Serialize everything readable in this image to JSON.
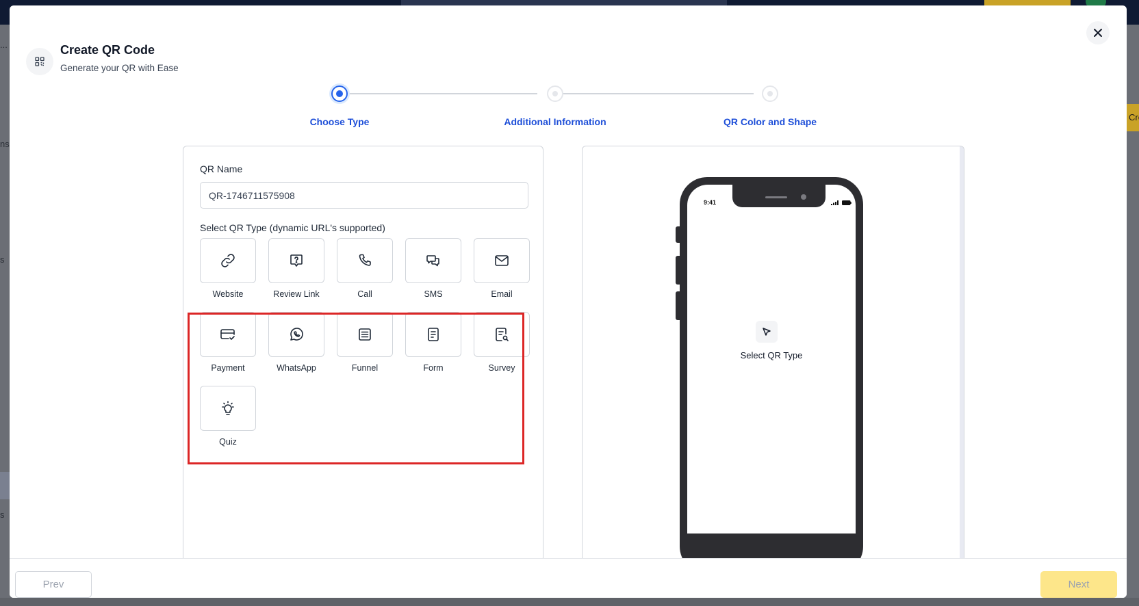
{
  "background": {
    "side_labels": [
      "...",
      "ns",
      "s",
      "s"
    ],
    "right_tab": "Cre"
  },
  "modal": {
    "title": "Create QR Code",
    "subtitle": "Generate your QR with Ease",
    "header_icon": "qr-code-icon",
    "close_icon": "close-icon"
  },
  "stepper": {
    "steps": [
      {
        "label": "Choose Type",
        "state": "active"
      },
      {
        "label": "Additional Information",
        "state": "pending"
      },
      {
        "label": "QR Color and Shape",
        "state": "pending"
      }
    ],
    "active_color": "#2563eb"
  },
  "form": {
    "name_label": "QR Name",
    "name_value": "QR-1746711575908",
    "type_label": "Select QR Type (dynamic URL's supported)",
    "types": [
      {
        "label": "Website",
        "icon": "link-icon"
      },
      {
        "label": "Review Link",
        "icon": "review-icon"
      },
      {
        "label": "Call",
        "icon": "phone-icon"
      },
      {
        "label": "SMS",
        "icon": "chat-icon"
      },
      {
        "label": "Email",
        "icon": "mail-icon"
      },
      {
        "label": "Payment",
        "icon": "credit-card-icon"
      },
      {
        "label": "WhatsApp",
        "icon": "whatsapp-icon"
      },
      {
        "label": "Funnel",
        "icon": "funnel-icon"
      },
      {
        "label": "Form",
        "icon": "form-icon"
      },
      {
        "label": "Survey",
        "icon": "survey-icon"
      },
      {
        "label": "Quiz",
        "icon": "lightbulb-icon"
      }
    ],
    "highlight_color": "#dc2626"
  },
  "preview": {
    "status_time": "9:41",
    "empty_text": "Select QR Type",
    "empty_icon": "cursor-icon"
  },
  "footer": {
    "prev_label": "Prev",
    "next_label": "Next",
    "next_color": "#fde68a"
  }
}
